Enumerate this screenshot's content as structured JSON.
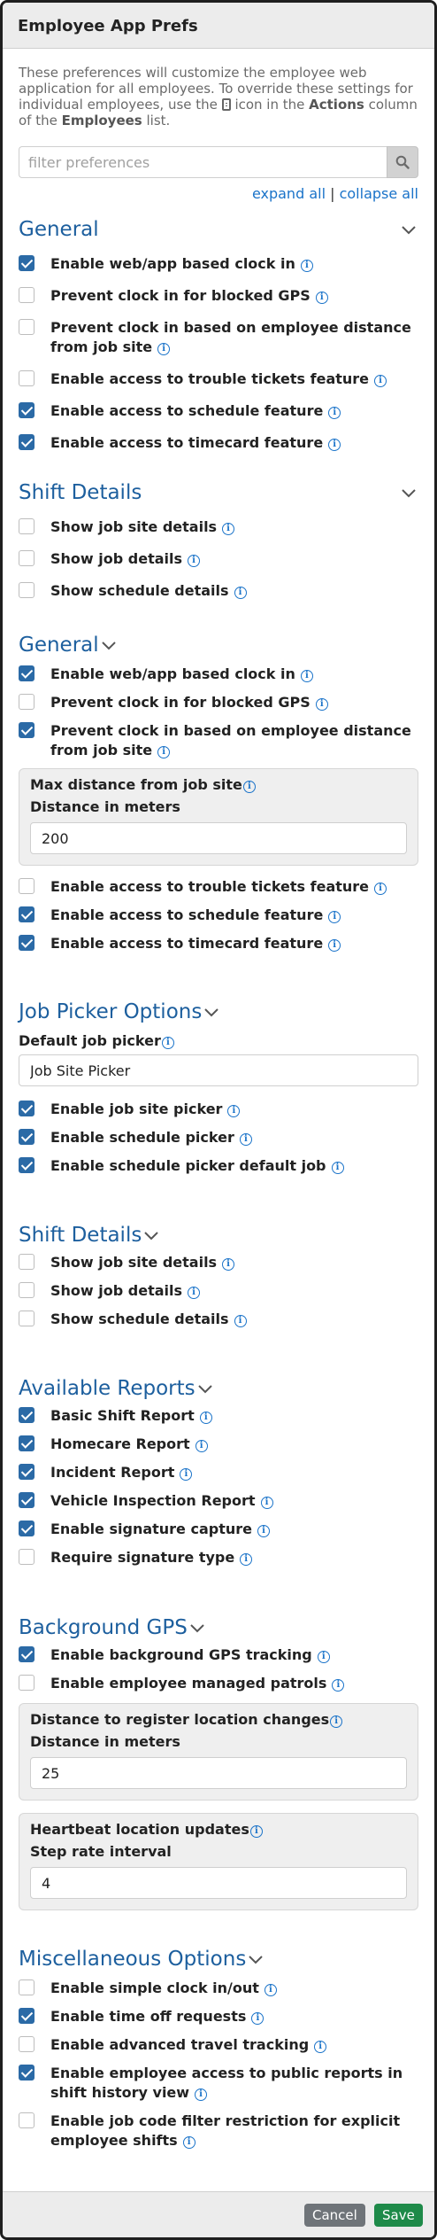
{
  "header": {
    "title": "Employee App Prefs"
  },
  "intro": {
    "part1": "These preferences will customize the employee web application for all employees. To override these settings for individual employees, use the ",
    "part2": " icon in the ",
    "bold1": "Actions",
    "part3": " column of the ",
    "bold2": "Employees",
    "part4": " list."
  },
  "search": {
    "placeholder": "filter preferences",
    "value": ""
  },
  "expand": {
    "expand_all": "expand all",
    "separator": "|",
    "collapse_all": "collapse all"
  },
  "s1": {
    "title": "General",
    "items": [
      {
        "label": "Enable web/app based clock in",
        "checked": true
      },
      {
        "label": "Prevent clock in for blocked GPS",
        "checked": false
      },
      {
        "label": "Prevent clock in based on employee distance from job site",
        "checked": false
      },
      {
        "label": "Enable access to trouble tickets feature",
        "checked": false
      },
      {
        "label": "Enable access to schedule feature",
        "checked": true
      },
      {
        "label": "Enable access to timecard feature",
        "checked": true
      }
    ]
  },
  "s2": {
    "title": "Shift Details",
    "items": [
      {
        "label": "Show job site details",
        "checked": false
      },
      {
        "label": "Show job details",
        "checked": false
      },
      {
        "label": "Show schedule details",
        "checked": false
      }
    ]
  },
  "s3": {
    "title": "General",
    "items_a": [
      {
        "label": "Enable web/app based clock in",
        "checked": true
      },
      {
        "label": "Prevent clock in for blocked GPS",
        "checked": false
      },
      {
        "label": "Prevent clock in based on employee distance from job site",
        "checked": true
      }
    ],
    "panel": {
      "title": "Max distance from job site",
      "label": "Distance in meters",
      "value": "200"
    },
    "items_b": [
      {
        "label": "Enable access to trouble tickets feature",
        "checked": false
      },
      {
        "label": "Enable access to schedule feature",
        "checked": true
      },
      {
        "label": "Enable access to timecard feature",
        "checked": true
      }
    ]
  },
  "s4": {
    "title": "Job Picker Options",
    "default_label": "Default job picker",
    "default_value": "Job Site Picker",
    "items": [
      {
        "label": "Enable job site picker",
        "checked": true
      },
      {
        "label": "Enable schedule picker",
        "checked": true
      },
      {
        "label": "Enable schedule picker default job",
        "checked": true
      }
    ]
  },
  "s5": {
    "title": "Shift Details",
    "items": [
      {
        "label": "Show job site details",
        "checked": false
      },
      {
        "label": "Show job details",
        "checked": false
      },
      {
        "label": "Show schedule details",
        "checked": false
      }
    ]
  },
  "s6": {
    "title": "Available Reports",
    "items": [
      {
        "label": "Basic Shift Report",
        "checked": true
      },
      {
        "label": "Homecare Report",
        "checked": true
      },
      {
        "label": "Incident Report",
        "checked": true
      },
      {
        "label": "Vehicle Inspection Report",
        "checked": true
      },
      {
        "label": "Enable signature capture",
        "checked": true
      },
      {
        "label": "Require signature type",
        "checked": false
      }
    ]
  },
  "s7": {
    "title": "Background GPS",
    "items": [
      {
        "label": "Enable background GPS tracking",
        "checked": true
      },
      {
        "label": "Enable employee managed patrols",
        "checked": false
      }
    ],
    "panel1": {
      "title": "Distance to register location changes",
      "label": "Distance in meters",
      "value": "25"
    },
    "panel2": {
      "title": "Heartbeat location updates",
      "label": "Step rate interval",
      "value": "4"
    }
  },
  "s8": {
    "title": "Miscellaneous Options",
    "items": [
      {
        "label": "Enable simple clock in/out",
        "checked": false
      },
      {
        "label": "Enable time off requests",
        "checked": true
      },
      {
        "label": "Enable advanced travel tracking",
        "checked": false
      },
      {
        "label": "Enable employee access to public reports in shift history view",
        "checked": true
      },
      {
        "label": "Enable job code filter restriction for explicit employee shifts",
        "checked": false
      }
    ]
  },
  "footer": {
    "cancel": "Cancel",
    "save": "Save"
  },
  "info_glyph": "i",
  "icons": {
    "search": "search-icon",
    "chevron": "chevron-down-icon",
    "info": "info-icon",
    "phone": "phone-icon"
  },
  "colors": {
    "accent": "#1d5f9e",
    "link": "#1a73c9",
    "check": "#2b6aa6",
    "save": "#1e8a49",
    "cancel": "#6f7479"
  }
}
